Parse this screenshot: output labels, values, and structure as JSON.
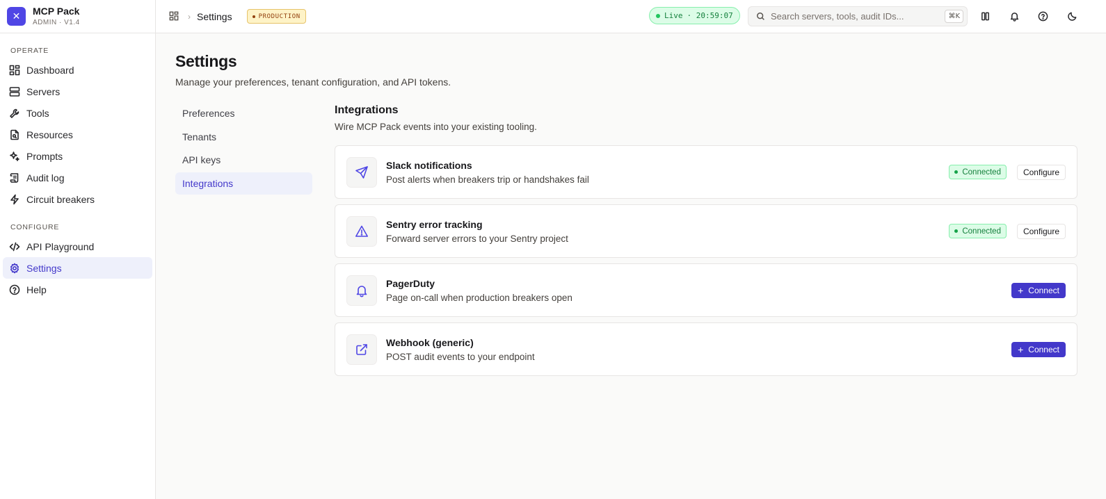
{
  "brand": {
    "name": "MCP Pack",
    "subtitle": "ADMIN · V1.4"
  },
  "sidebar": {
    "operate_label": "OPERATE",
    "operate_items": [
      {
        "label": "Dashboard",
        "icon": "dashboard-icon"
      },
      {
        "label": "Servers",
        "icon": "servers-icon"
      },
      {
        "label": "Tools",
        "icon": "wrench-icon"
      },
      {
        "label": "Resources",
        "icon": "file-search-icon"
      },
      {
        "label": "Prompts",
        "icon": "sparkles-icon"
      },
      {
        "label": "Audit log",
        "icon": "scroll-icon"
      },
      {
        "label": "Circuit breakers",
        "icon": "zap-icon"
      }
    ],
    "configure_label": "CONFIGURE",
    "configure_items": [
      {
        "label": "API Playground",
        "icon": "code-icon"
      },
      {
        "label": "Settings",
        "icon": "gear-icon",
        "active": true
      },
      {
        "label": "Help",
        "icon": "help-circle-icon"
      }
    ]
  },
  "topbar": {
    "breadcrumb_current": "Settings",
    "env_badge": "PRODUCTION",
    "live_label": "Live",
    "live_time": "· 20:59:07",
    "search_placeholder": "Search servers, tools, audit IDs...",
    "search_shortcut": "⌘K"
  },
  "page": {
    "title": "Settings",
    "subtitle": "Manage your preferences, tenant configuration, and API tokens."
  },
  "subnav": [
    {
      "label": "Preferences"
    },
    {
      "label": "Tenants"
    },
    {
      "label": "API keys"
    },
    {
      "label": "Integrations",
      "active": true
    }
  ],
  "integrations": {
    "title": "Integrations",
    "subtitle": "Wire MCP Pack events into your existing tooling.",
    "items": [
      {
        "name": "Slack notifications",
        "description": "Post alerts when breakers trip or handshakes fail",
        "icon": "send-icon",
        "status": "Connected",
        "action": "Configure"
      },
      {
        "name": "Sentry error tracking",
        "description": "Forward server errors to your Sentry project",
        "icon": "alert-triangle-icon",
        "status": "Connected",
        "action": "Configure"
      },
      {
        "name": "PagerDuty",
        "description": "Page on-call when production breakers open",
        "icon": "bell-icon",
        "status": "",
        "action": "Connect"
      },
      {
        "name": "Webhook (generic)",
        "description": "POST audit events to your endpoint",
        "icon": "external-link-icon",
        "status": "",
        "action": "Connect"
      }
    ]
  },
  "colors": {
    "accent": "#4338ca",
    "connected_bg": "#dcfce7",
    "connected_text": "#15803d",
    "production_bg": "#fef3c7"
  }
}
